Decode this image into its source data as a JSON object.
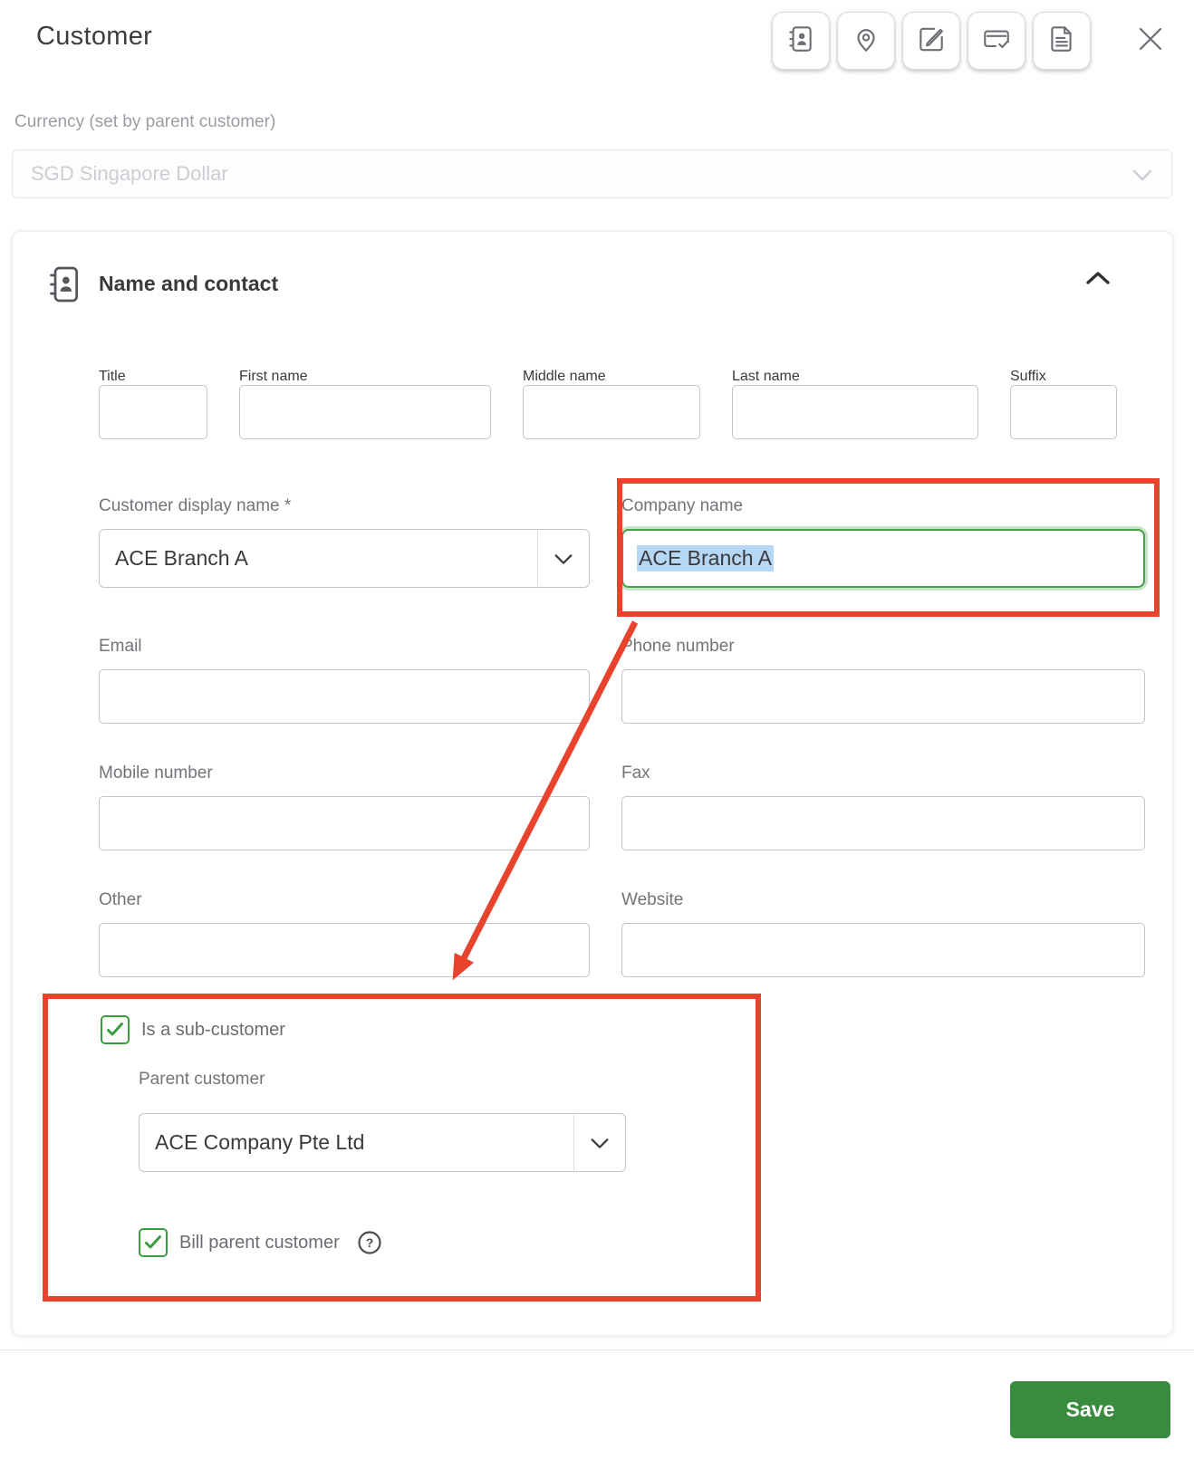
{
  "window": {
    "title": "Customer"
  },
  "toolbar": {
    "icons": [
      "contact-card",
      "location-pin",
      "edit-note",
      "payment-card",
      "document-notes"
    ]
  },
  "currency": {
    "label": "Currency (set by parent customer)",
    "value": "SGD Singapore Dollar"
  },
  "name_contact": {
    "section_title": "Name and contact",
    "fields": {
      "title": {
        "label": "Title",
        "value": ""
      },
      "first_name": {
        "label": "First name",
        "value": ""
      },
      "middle_name": {
        "label": "Middle name",
        "value": ""
      },
      "last_name": {
        "label": "Last name",
        "value": ""
      },
      "suffix": {
        "label": "Suffix",
        "value": ""
      },
      "display_name": {
        "label": "Customer display name *",
        "value": "ACE Branch A"
      },
      "company_name": {
        "label": "Company name",
        "value": "ACE Branch A",
        "text_selected": true
      },
      "email": {
        "label": "Email",
        "value": ""
      },
      "phone": {
        "label": "Phone number",
        "value": ""
      },
      "mobile": {
        "label": "Mobile number",
        "value": ""
      },
      "fax": {
        "label": "Fax",
        "value": ""
      },
      "other": {
        "label": "Other",
        "value": ""
      },
      "website": {
        "label": "Website",
        "value": ""
      }
    }
  },
  "sub_customer": {
    "is_sub_label": "Is a sub-customer",
    "is_sub_checked": true,
    "parent_label": "Parent customer",
    "parent_value": "ACE Company Pte Ltd",
    "bill_label": "Bill parent customer",
    "bill_checked": true,
    "help_glyph": "?"
  },
  "footer": {
    "save_label": "Save"
  },
  "colors": {
    "annotation_red": "#e8432c",
    "checkbox_green": "#3a9e41",
    "save_green": "#398b3e",
    "focus_green": "#43a047",
    "selection_blue": "#b7d7f6"
  }
}
